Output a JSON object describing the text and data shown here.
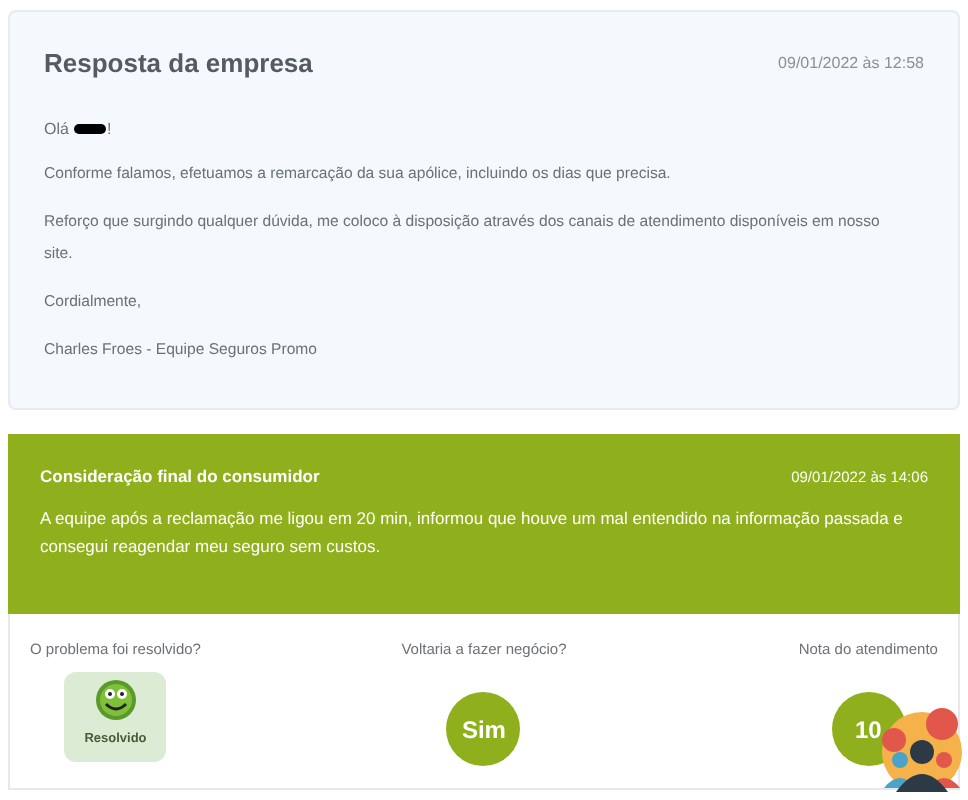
{
  "company_reply": {
    "title": "Resposta da empresa",
    "date": "09/01/2022 às 12:58",
    "greeting": {
      "before": "Olá",
      "redacted": true,
      "after": "!"
    },
    "paragraphs": [
      "Conforme falamos, efetuamos a remarcação da sua apólice, incluindo os dias que precisa.",
      "Reforço que surgindo qualquer dúvida, me coloco à disposição através dos canais de atendimento disponíveis em nosso site.",
      "Cordialmente,",
      "Charles Froes - Equipe Seguros Promo"
    ]
  },
  "consumer_final": {
    "title": "Consideração final do consumidor",
    "date": "09/01/2022 às 14:06",
    "text": "A equipe após a reclamação me ligou em 20 min, informou que houve um mal entendido na informação passada e consegui reagendar meu seguro sem custos."
  },
  "ratings": [
    {
      "label": "O problema foi resolvido?",
      "kind": "badge",
      "value": "Resolvido"
    },
    {
      "label": "Voltaria a fazer negócio?",
      "kind": "circle",
      "value": "Sim"
    },
    {
      "label": "Nota do atendimento",
      "kind": "circle",
      "value": "10"
    }
  ]
}
